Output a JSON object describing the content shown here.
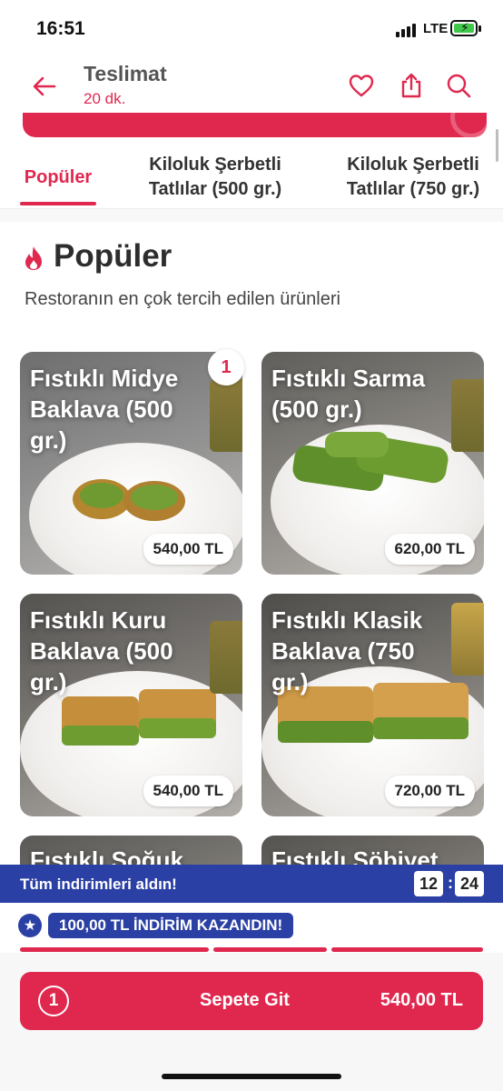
{
  "status": {
    "time": "16:51",
    "network": "LTE"
  },
  "header": {
    "title": "Teslimat",
    "subtitle": "20 dk."
  },
  "tabs": [
    {
      "label": "Popüler"
    },
    {
      "label": "Kiloluk Şerbetli Tatlılar (500 gr.)"
    },
    {
      "label": "Kiloluk Şerbetli Tatlılar (750 gr.)"
    }
  ],
  "section": {
    "title": "Popüler",
    "subtitle": "Restoranın en çok tercih edilen ürünleri"
  },
  "products": [
    {
      "name": "Fıstıklı Midye Baklava (500 gr.)",
      "price": "540,00 TL",
      "count": "1"
    },
    {
      "name": "Fıstıklı Sarma (500 gr.)",
      "price": "620,00 TL"
    },
    {
      "name": "Fıstıklı Kuru Baklava (500 gr.)",
      "price": "540,00 TL"
    },
    {
      "name": "Fıstıklı Klasik Baklava (750 gr.)",
      "price": "720,00 TL"
    },
    {
      "name": "Fıstıklı Soğuk"
    },
    {
      "name": "Fıstıklı Şöbiyet"
    }
  ],
  "discount": {
    "text": "Tüm indirimleri aldın!",
    "timer_minutes": "12",
    "timer_separator": ":",
    "timer_seconds": "24",
    "win_text": "100,00 TL İNDİRİM KAZANDIN!"
  },
  "cart": {
    "count": "1",
    "label": "Sepete Git",
    "total": "540,00 TL"
  },
  "colors": {
    "primary": "#e0284f",
    "discount_blue": "#2b40a4",
    "title_gray": "#555555"
  }
}
